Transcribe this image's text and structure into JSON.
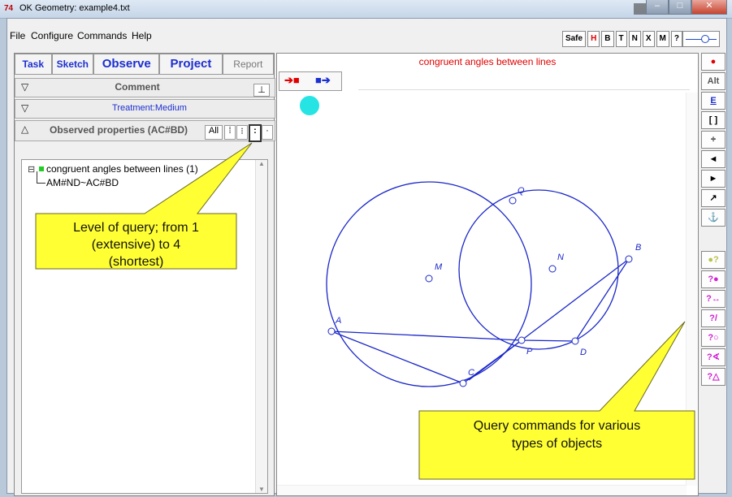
{
  "window": {
    "title": "OK Geometry: example4.txt",
    "app_icon": "74"
  },
  "menu": [
    "File",
    "Configure",
    "Commands",
    "Help"
  ],
  "toolbar": {
    "buttons": [
      "Safe",
      "H",
      "B",
      "T",
      "N",
      "X",
      "M",
      "?"
    ]
  },
  "tabs": [
    "Task",
    "Sketch",
    "Observe",
    "Project",
    "Report"
  ],
  "comment_section": {
    "label": "Comment",
    "button": "⊥"
  },
  "treatment_section": {
    "label": "Treatment:Medium"
  },
  "observed_section": {
    "label": "Observed properties (AC#BD)",
    "buttons": [
      "All",
      "⁞",
      "⁝",
      ":",
      "·"
    ]
  },
  "tree": {
    "root": "congruent angles between lines (1)",
    "child": "AM#ND~AC#BD",
    "expand": "⊟"
  },
  "canvas": {
    "title": "congruent angles between lines",
    "points": [
      "Q",
      "N",
      "M",
      "B",
      "A",
      "P",
      "D",
      "C"
    ]
  },
  "sidebar_buttons": [
    "●",
    "Alt",
    "E",
    "[ ]",
    "÷",
    "◄",
    "►",
    "↗",
    "⚓",
    "●?",
    "?●",
    "?↔",
    "?/",
    "?○",
    "?∢",
    "?△"
  ],
  "callouts": {
    "level": "Level of query; from 1 (extensive) to 4 (shortest)",
    "level_lines": [
      "Level of query; from 1",
      "(extensive) to 4",
      "(shortest)"
    ],
    "query": "Query commands for various types of objects",
    "query_lines": [
      "Query commands for various",
      "types of objects"
    ]
  },
  "colors": {
    "accent_blue": "#1c2fd0",
    "geometry": "#1a27c8",
    "title_red": "#e00000",
    "callout": "#ffff33",
    "query_magenta": "#d21fd2"
  }
}
